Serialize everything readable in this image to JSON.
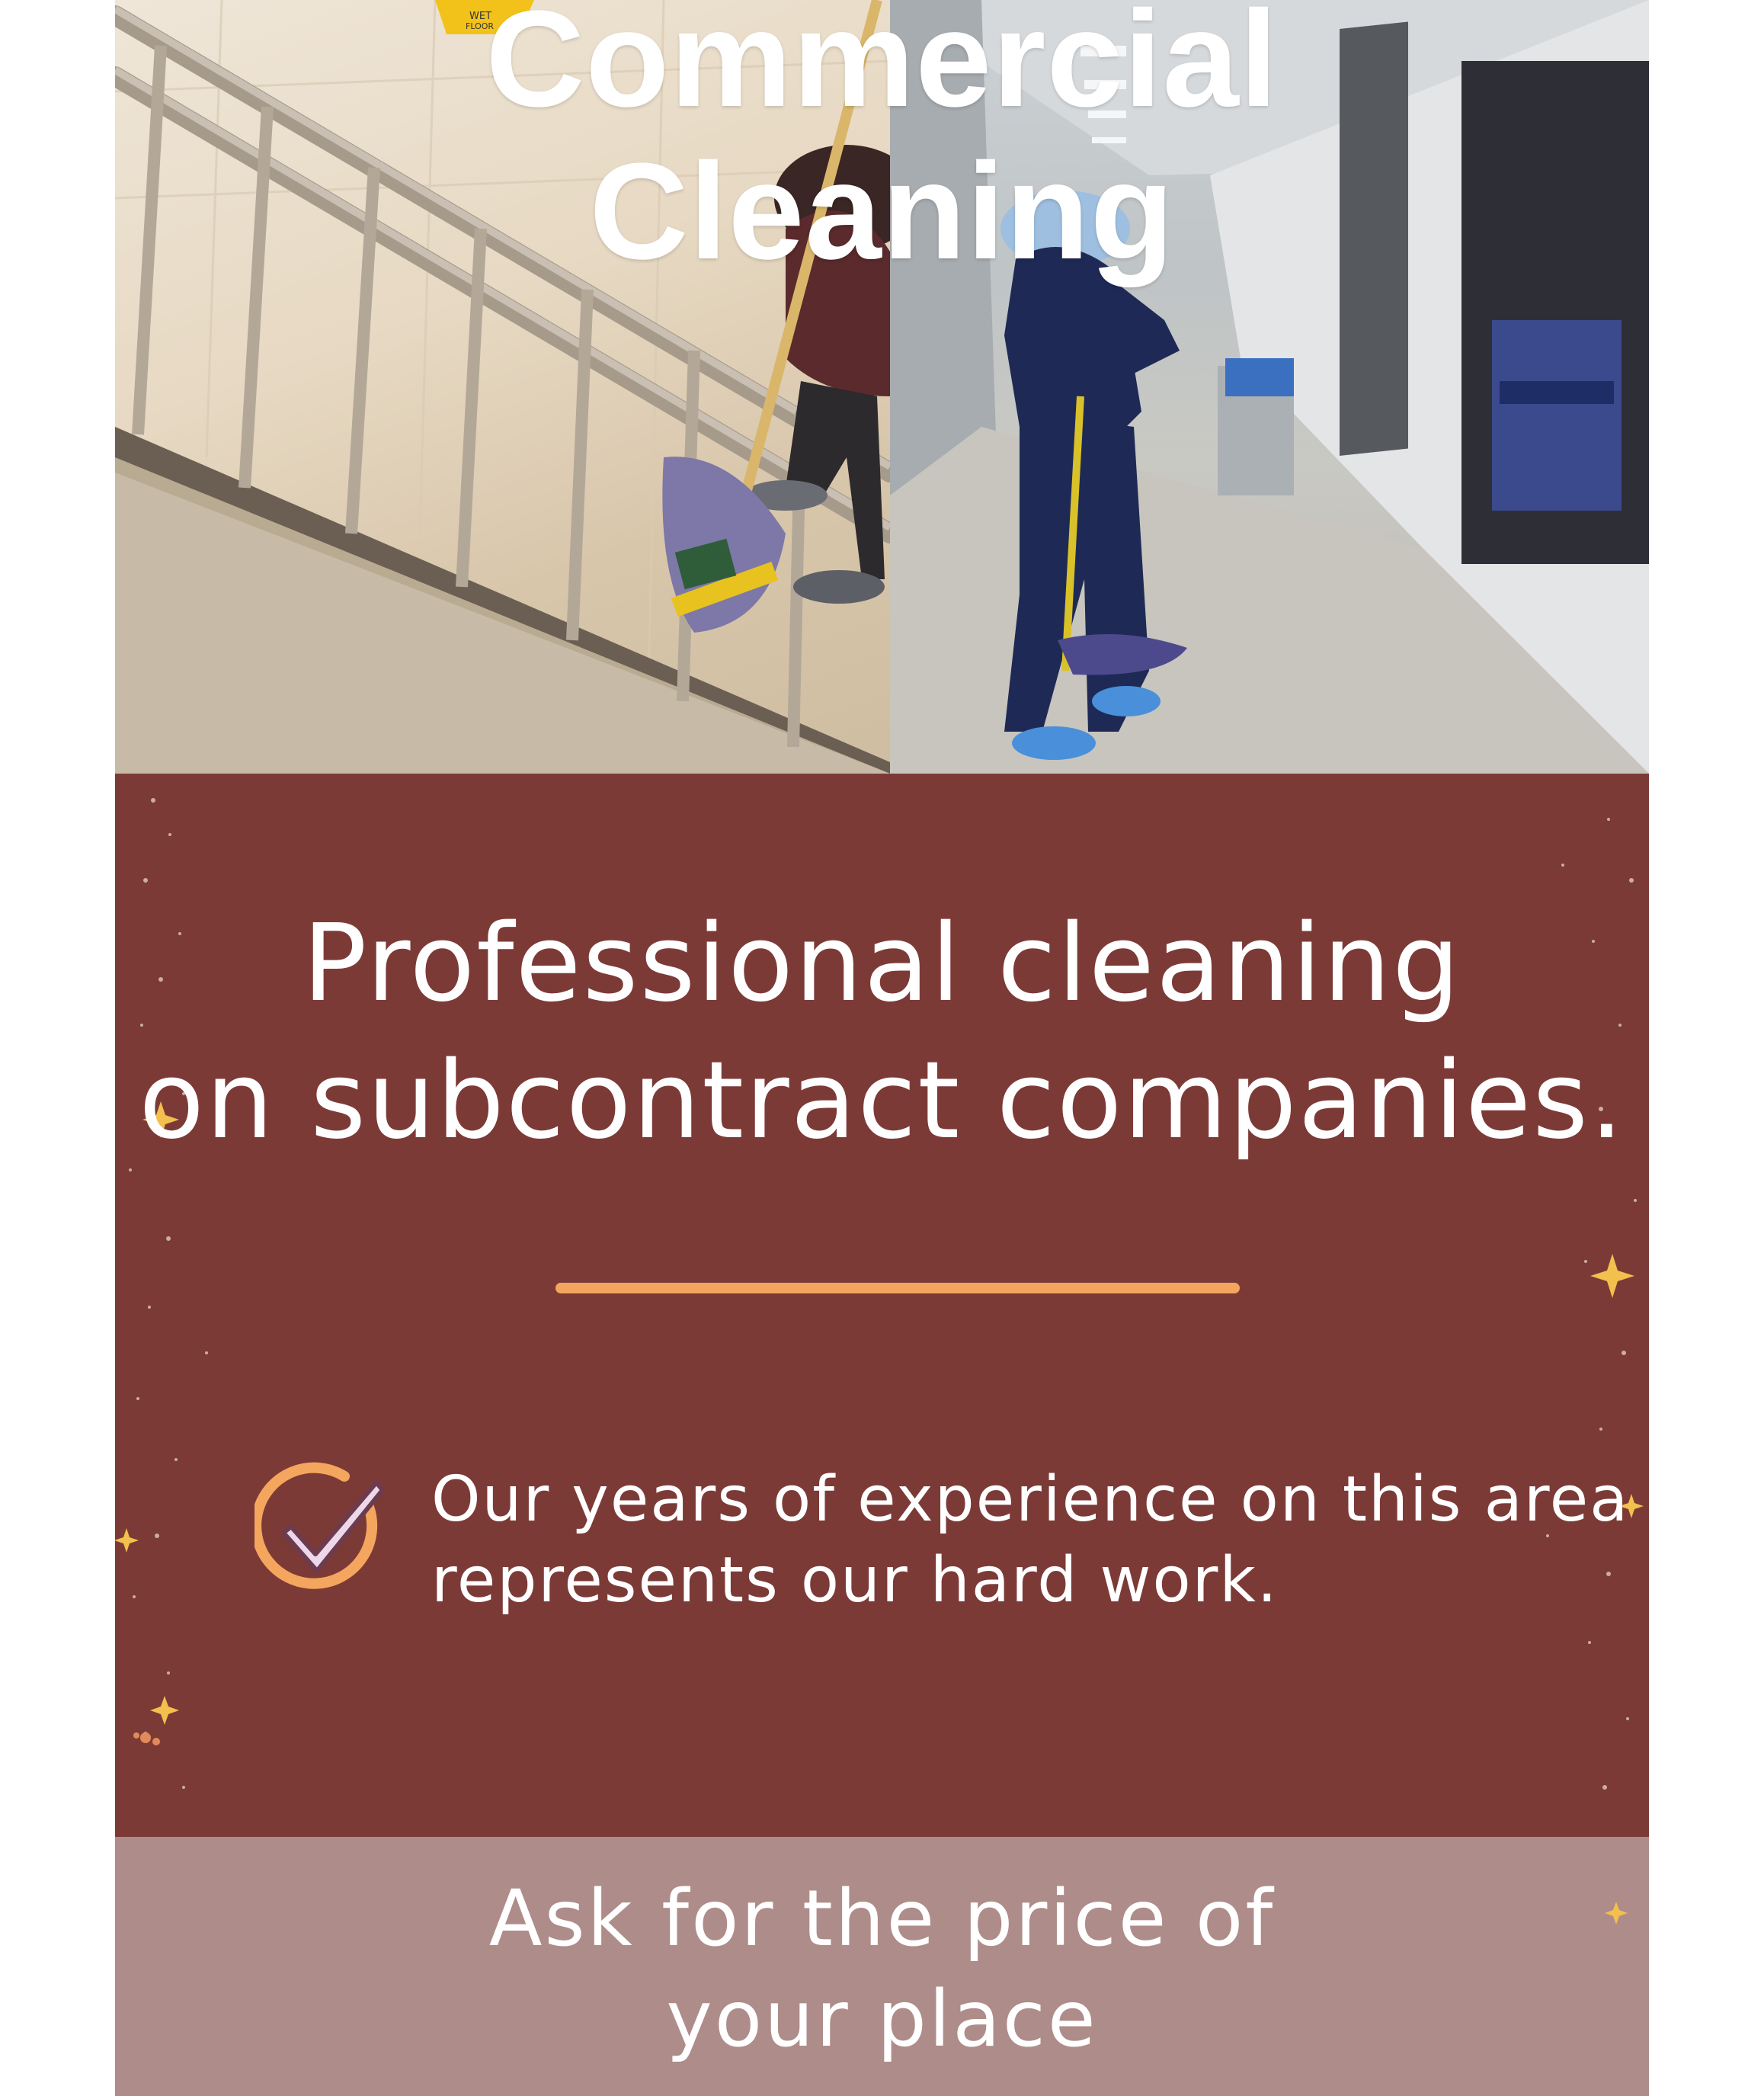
{
  "hero": {
    "title_line1": "Commercial",
    "title_line2": "Cleaning",
    "sign_text_line1": "WET",
    "sign_text_line2": "FLOOR"
  },
  "panel": {
    "headline_line1": "Professional cleaning",
    "headline_line2": "on subcontract companies.",
    "experience_line1": "Our  years of experience on this area",
    "experience_line2": "represents our hard work."
  },
  "price": {
    "line1": "Ask for the price of",
    "line2": "your place"
  },
  "colors": {
    "panel": "#7c3a37",
    "price_band": "#ae8c89",
    "accent": "#f4a65e",
    "check": "#ecd8ea"
  },
  "icons": {
    "check": "check-circle-icon",
    "sparkle": "sparkle-icon"
  }
}
